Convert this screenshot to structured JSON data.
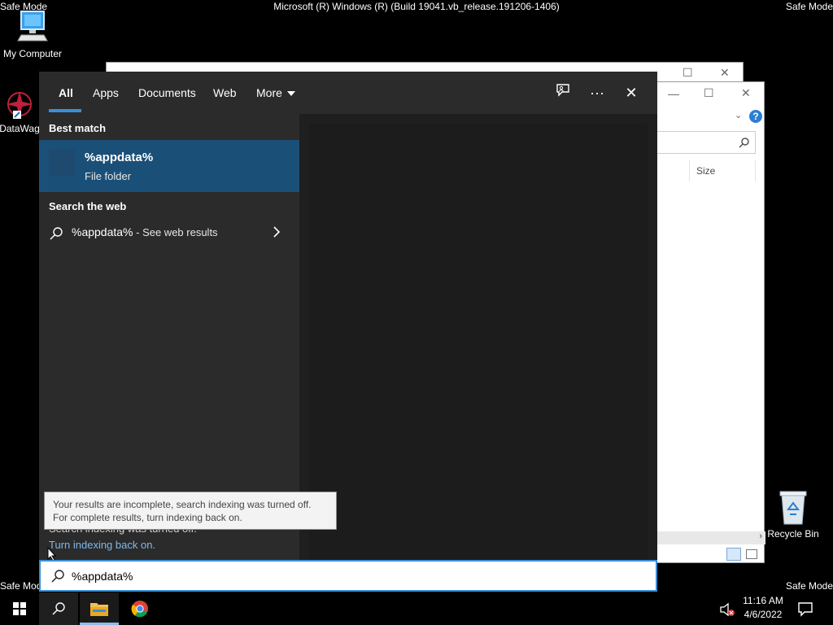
{
  "desktop": {
    "corner_label": "Safe Mode",
    "build_title": "Microsoft (R) Windows (R) (Build 19041.vb_release.191206-1406)",
    "icons": [
      {
        "label": "My Computer"
      },
      {
        "label": "DataWag"
      },
      {
        "label": "Recycle Bin"
      }
    ]
  },
  "background_window": {
    "size_column": "Size"
  },
  "search": {
    "tabs": [
      {
        "label": "All"
      },
      {
        "label": "Apps"
      },
      {
        "label": "Documents"
      },
      {
        "label": "Web"
      },
      {
        "label": "More"
      }
    ],
    "best_match_header": "Best match",
    "best_match": {
      "name": "%appdata%",
      "type": "File folder"
    },
    "web_header": "Search the web",
    "web_result": {
      "query": "%appdata%",
      "suffix": " - See web results"
    },
    "indexing_notice": "Search indexing was turned off.",
    "indexing_link": "Turn indexing back on.",
    "tooltip": "Your results are incomplete, search indexing was turned off. For complete results, turn indexing back on.",
    "input_value": "%appdata%"
  },
  "taskbar": {
    "time": "11:16 AM",
    "date": "4/6/2022"
  },
  "colors": {
    "accent": "#3a8fd8",
    "selection": "#1a4f78",
    "link": "#7fb8ea"
  }
}
